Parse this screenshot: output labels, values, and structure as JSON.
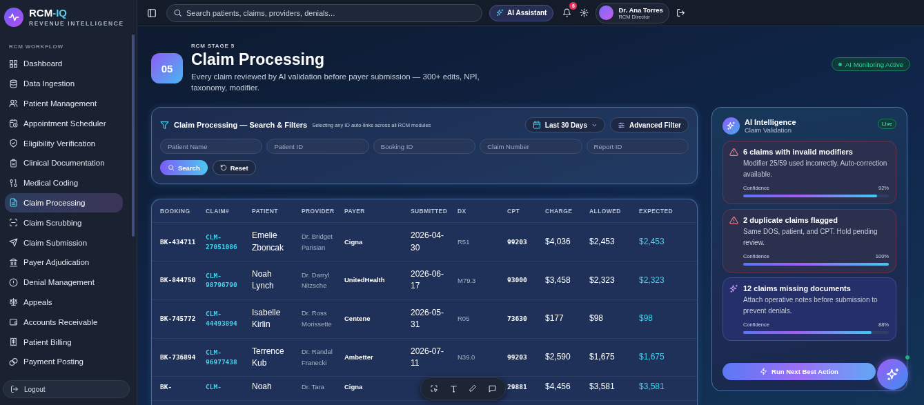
{
  "brand": {
    "name": "RCM",
    "accent": "-IQ",
    "tagline": "REVENUE INTELLIGENCE"
  },
  "sidebar": {
    "section": "RCM WORKFLOW",
    "items": [
      {
        "label": "Dashboard",
        "selected": false
      },
      {
        "label": "Data Ingestion",
        "selected": false
      },
      {
        "label": "Patient Management",
        "selected": false
      },
      {
        "label": "Appointment Scheduler",
        "selected": false
      },
      {
        "label": "Eligibility Verification",
        "selected": false
      },
      {
        "label": "Clinical Documentation",
        "selected": false
      },
      {
        "label": "Medical Coding",
        "selected": false
      },
      {
        "label": "Claim Processing",
        "selected": true
      },
      {
        "label": "Claim Scrubbing",
        "selected": false
      },
      {
        "label": "Claim Submission",
        "selected": false
      },
      {
        "label": "Payer Adjudication",
        "selected": false
      },
      {
        "label": "Denial Management",
        "selected": false
      },
      {
        "label": "Appeals",
        "selected": false
      },
      {
        "label": "Accounts Receivable",
        "selected": false
      },
      {
        "label": "Patient Billing",
        "selected": false
      },
      {
        "label": "Payment Posting",
        "selected": false
      }
    ],
    "logout": "Logout"
  },
  "topbar": {
    "search": {
      "placeholder": "Search patients, claims, providers, denials..."
    },
    "ai_button": "AI Assistant",
    "notifications": "6",
    "user": {
      "name": "Dr. Ana Torres",
      "role": "RCM Director"
    }
  },
  "header": {
    "stage_number": "05",
    "stage_label": "RCM STAGE 5",
    "title": "Claim Processing",
    "description": "Every claim reviewed by AI validation before payer submission — 300+ edits, NPI, taxonomy, modifier.",
    "status": "AI Monitoring Active"
  },
  "filters": {
    "title": "Claim Processing — Search & Filters",
    "note": "Selecting any ID auto-links across all RCM modules",
    "date_range": "Last 30 Days",
    "advanced": "Advanced Filter",
    "fields": [
      {
        "placeholder": "Patient Name"
      },
      {
        "placeholder": "Patient ID"
      },
      {
        "placeholder": "Booking ID"
      },
      {
        "placeholder": "Claim Number"
      },
      {
        "placeholder": "Report ID"
      }
    ],
    "search": "Search",
    "reset": "Reset"
  },
  "table": {
    "columns": [
      "BOOKING",
      "CLAIM#",
      "PATIENT",
      "PROVIDER",
      "PAYER",
      "SUBMITTED",
      "DX",
      "CPT",
      "CHARGE",
      "ALLOWED",
      "EXPECTED"
    ],
    "rows": [
      {
        "booking": "BK-434711",
        "claim": "CLM-27051086",
        "patient": "Emelie Zboncak",
        "provider": "Dr. Bridget Parisian",
        "payer": "Cigna",
        "submitted": "2026-04-30",
        "dx": "R51",
        "cpt": "99203",
        "charge": "$4,036",
        "allowed": "$2,453",
        "expected": "$2,453"
      },
      {
        "booking": "BK-844750",
        "claim": "CLM-98796790",
        "patient": "Noah Lynch",
        "provider": "Dr. Darryl Nitzsche",
        "payer": "UnitedHealth",
        "submitted": "2026-06-17",
        "dx": "M79.3",
        "cpt": "93000",
        "charge": "$3,458",
        "allowed": "$2,323",
        "expected": "$2,323"
      },
      {
        "booking": "BK-745772",
        "claim": "CLM-44493894",
        "patient": "Isabelle Kirlin",
        "provider": "Dr. Ross Morissette",
        "payer": "Centene",
        "submitted": "2026-05-31",
        "dx": "R05",
        "cpt": "73630",
        "charge": "$177",
        "allowed": "$98",
        "expected": "$98"
      },
      {
        "booking": "BK-736894",
        "claim": "CLM-96977438",
        "patient": "Terrence Kub",
        "provider": "Dr. Randal Franecki",
        "payer": "Ambetter",
        "submitted": "2026-07-11",
        "dx": "N39.0",
        "cpt": "99203",
        "charge": "$2,590",
        "allowed": "$1,675",
        "expected": "$1,675"
      },
      {
        "booking": "BK-",
        "claim": "CLM-",
        "patient": "Noah",
        "provider": "Dr. Tara",
        "payer": "Cigna",
        "cpt": "29881",
        "charge": "$4,456",
        "allowed": "$3,581",
        "expected": "$3,581"
      }
    ]
  },
  "ai_panel": {
    "title": "AI Intelligence",
    "subtitle": "Claim Validation",
    "status": "Live",
    "insights": [
      {
        "kind": "warning",
        "title": "6 claims with invalid modifiers",
        "text": "Modifier 25/59 used incorrectly. Auto-correction available.",
        "confidence_label": "Confidence",
        "confidence": "92%",
        "level": 0.92
      },
      {
        "kind": "warning",
        "title": "2 duplicate claims flagged",
        "text": "Same DOS, patient, and CPT. Hold pending review.",
        "confidence_label": "Confidence",
        "confidence": "100%",
        "level": 1.0
      },
      {
        "kind": "insight",
        "title": "12 claims missing documents",
        "text": "Attach operative notes before submission to prevent denials.",
        "confidence_label": "Confidence",
        "confidence": "88%",
        "level": 0.88
      }
    ],
    "action": "Run Next Best Action"
  }
}
